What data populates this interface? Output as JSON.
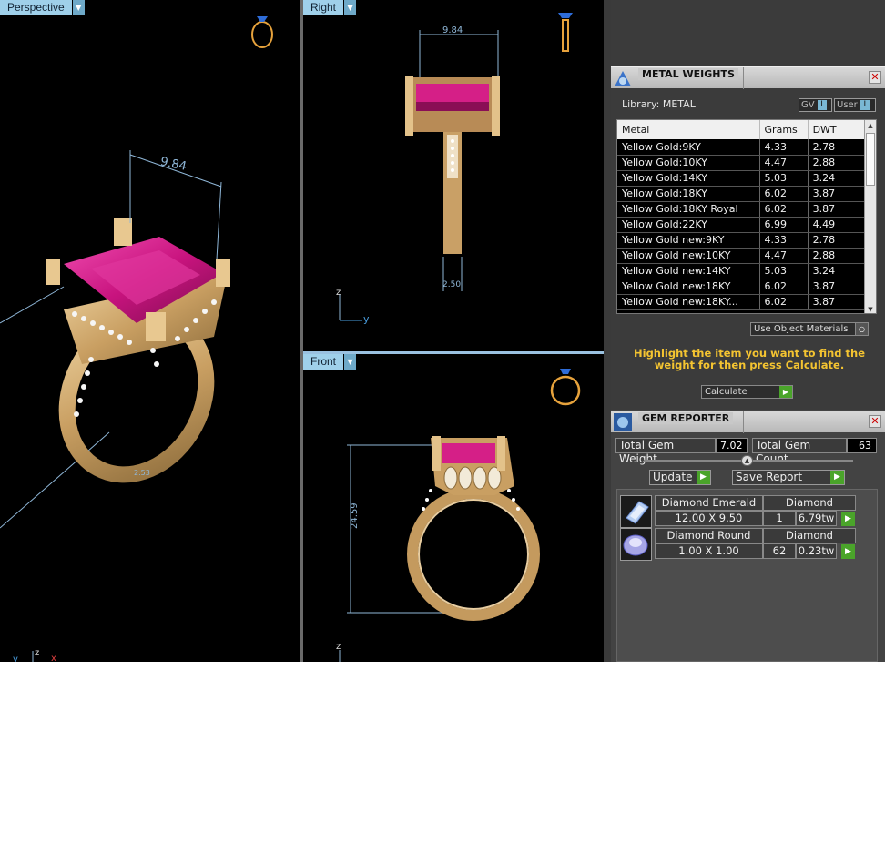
{
  "viewports": {
    "perspective": {
      "label": "Perspective",
      "dimension": "9.84",
      "dimension_small": "2.53",
      "axes": {
        "z": "z",
        "x": "x",
        "y": "y"
      }
    },
    "right": {
      "label": "Right",
      "dimension_top": "9.84",
      "dimension_bottom": "2.50",
      "axes": {
        "z": "z",
        "y": "y"
      }
    },
    "front": {
      "label": "Front",
      "dimension_height": "24.59",
      "axes": {
        "z": "z"
      }
    }
  },
  "metal_weights": {
    "title": "METAL WEIGHTS",
    "library_label": "Library: METAL",
    "toggle_gv": "GV",
    "toggle_user": "User",
    "columns": [
      "Metal",
      "Grams",
      "DWT"
    ],
    "rows": [
      {
        "metal": "Yellow Gold:9KY",
        "grams": "4.33",
        "dwt": "2.78"
      },
      {
        "metal": "Yellow Gold:10KY",
        "grams": "4.47",
        "dwt": "2.88"
      },
      {
        "metal": "Yellow Gold:14KY",
        "grams": "5.03",
        "dwt": "3.24"
      },
      {
        "metal": "Yellow Gold:18KY",
        "grams": "6.02",
        "dwt": "3.87"
      },
      {
        "metal": "Yellow Gold:18KY Royal",
        "grams": "6.02",
        "dwt": "3.87"
      },
      {
        "metal": "Yellow Gold:22KY",
        "grams": "6.99",
        "dwt": "4.49"
      },
      {
        "metal": "Yellow Gold new:9KY",
        "grams": "4.33",
        "dwt": "2.78"
      },
      {
        "metal": "Yellow Gold new:10KY",
        "grams": "4.47",
        "dwt": "2.88"
      },
      {
        "metal": "Yellow Gold new:14KY",
        "grams": "5.03",
        "dwt": "3.24"
      },
      {
        "metal": "Yellow Gold new:18KY",
        "grams": "6.02",
        "dwt": "3.87"
      },
      {
        "metal": "Yellow Gold new:18KY...",
        "grams": "6.02",
        "dwt": "3.87"
      }
    ],
    "use_object_materials": "Use Object Materials",
    "instruction": "Highlight the item you want to find the weight for then press Calculate.",
    "calculate_label": "Calculate"
  },
  "gem_reporter": {
    "title": "GEM REPORTER",
    "total_weight_label": "Total Gem Weight",
    "total_weight_value": "7.02",
    "total_count_label": "Total Gem Count",
    "total_count_value": "63",
    "update_label": "Update",
    "save_report_label": "Save Report",
    "gems": [
      {
        "name": "Diamond Emerald",
        "material": "Diamond",
        "size": "12.00 X 9.50",
        "count": "1",
        "weight": "6.79tw",
        "icon": "emerald-cut-gem-icon"
      },
      {
        "name": "Diamond Round",
        "material": "Diamond",
        "size": "1.00 X 1.00",
        "count": "62",
        "weight": "0.23tw",
        "icon": "round-cut-gem-icon"
      }
    ]
  },
  "colors": {
    "viewport_bg": "#000000",
    "gold": "#d8b27a",
    "ruby": "#d6208a",
    "dim_line": "#8fb7d8",
    "accent_go": "#4aa42a",
    "instruction_text": "#f4c431"
  }
}
